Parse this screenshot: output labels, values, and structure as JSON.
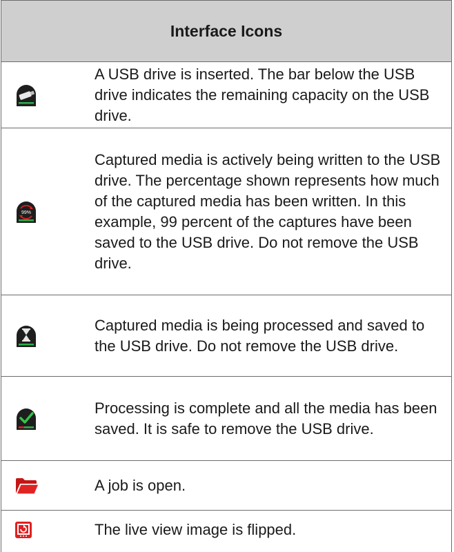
{
  "table": {
    "header": "Interface Icons",
    "rows": [
      {
        "icon": "usb-drive-icon",
        "description": "A USB drive is inserted. The bar below the USB drive indicates the remaining capacity on the USB drive."
      },
      {
        "icon": "usb-writing-progress-icon",
        "icon_text": "99%",
        "description": "Captured media is actively being written to the USB drive. The percentage shown represents how much of the captured media has been written. In this example, 99 percent of the captures have been saved to the USB drive. Do not remove the USB drive."
      },
      {
        "icon": "hourglass-icon",
        "description": "Captured media is being processed and saved to the USB drive. Do not remove the USB drive."
      },
      {
        "icon": "checkmark-icon",
        "description": "Processing is complete and all the media has been saved. It is safe to remove the USB drive."
      },
      {
        "icon": "open-folder-icon",
        "description": "A job is open."
      },
      {
        "icon": "image-flip-icon",
        "description": "The live view image is flipped."
      }
    ]
  },
  "colors": {
    "header_bg": "#cfcfcf",
    "border": "#6b6b6b",
    "icon_dark": "#1e1e1e",
    "capacity_green": "#2fb04a",
    "status_red": "#e02020",
    "check_green": "#36c24a"
  }
}
